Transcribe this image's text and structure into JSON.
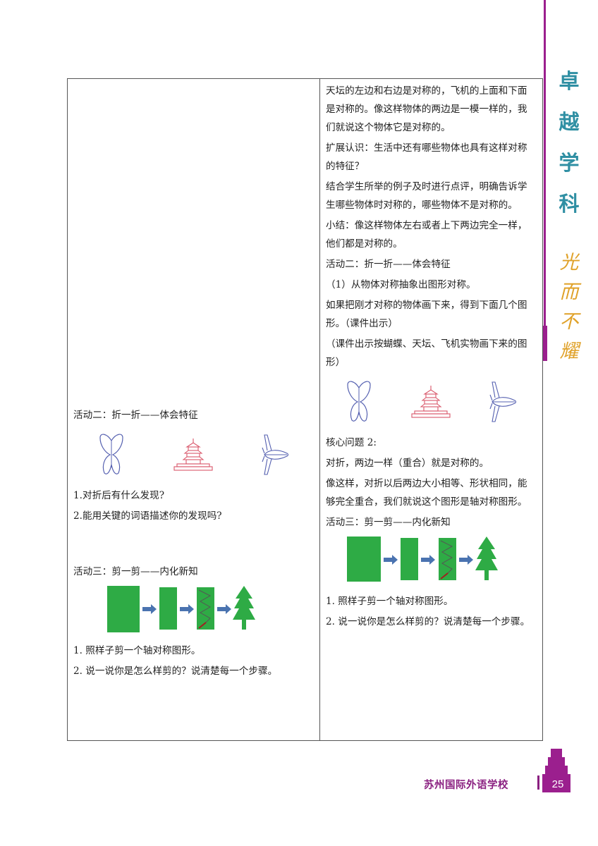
{
  "side": {
    "slogan1": [
      "卓",
      "越",
      "学",
      "科"
    ],
    "slogan2": [
      "光",
      "而",
      "不",
      "耀"
    ]
  },
  "left": {
    "activity2_title": "活动二：折一折——体会特征",
    "q1": "1.对折后有什么发现?",
    "q2": "2.能用关键的词语描述你的发现吗?",
    "activity3_title": "活动三：剪一剪——内化新知",
    "step1": "1. 照样子剪一个轴对称图形。",
    "step2": "2. 说一说你是怎么样剪的？说清楚每一个步骤。"
  },
  "right": {
    "p1": "天坛的左边和右边是对称的，飞机的上面和下面是对称的。像这样物体的两边是一模一样的，我们就说这个物体它是对称的。",
    "p2": "扩展认识：生活中还有哪些物体也具有这样对称的特征？",
    "p3": "结合学生所举的例子及时进行点评，明确告诉学生哪些物体时对称的，哪些物体不是对称的。",
    "p4": "小结：像这样物体左右或者上下两边完全一样，他们都是对称的。",
    "p5": "活动二：折一折——体会特征",
    "p6": "（1）从物体对称抽象出图形对称。",
    "p7": "如果把刚才对称的物体画下来，得到下面几个图形。（课件出示）",
    "p8": "（课件出示按蝴蝶、天坛、飞机实物画下来的图形）",
    "p9": "核心问题 2:",
    "p10": "对折，两边一样（重合）就是对称的。",
    "p11": "像这样，对折以后两边大小相等、形状相同，能够完全重合，我们就说这个图形是轴对称图形。",
    "p12": "活动三：剪一剪——内化新知",
    "p13": "1. 照样子剪一个轴对称图形。",
    "p14": "2. 说一说你是怎么样剪的？说清楚每一个步骤。"
  },
  "footer": {
    "school": "苏州国际外语学校",
    "page": "25"
  },
  "colors": {
    "purple": "#9b1f8e",
    "teal": "#2f8fa3",
    "gold": "#e0a22a",
    "green": "#2eab45",
    "arrow_blue": "#4a73b0"
  }
}
